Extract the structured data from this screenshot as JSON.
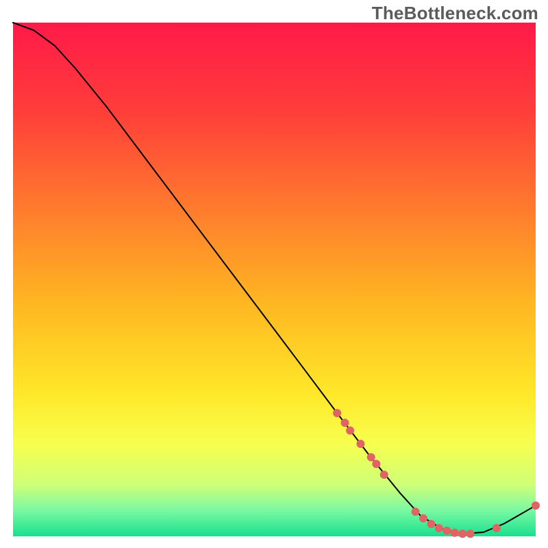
{
  "watermark": "TheBottleneck.com",
  "chart_data": {
    "type": "line",
    "title": "",
    "xlabel": "",
    "ylabel": "",
    "xlim": [
      0,
      100
    ],
    "ylim": [
      0,
      100
    ],
    "axes_visible": false,
    "grid": false,
    "background_gradient": {
      "orientation": "vertical",
      "stops": [
        {
          "offset": 0.0,
          "color": "#ff1a49"
        },
        {
          "offset": 0.17,
          "color": "#ff3d3a"
        },
        {
          "offset": 0.35,
          "color": "#ff772e"
        },
        {
          "offset": 0.55,
          "color": "#ffb822"
        },
        {
          "offset": 0.72,
          "color": "#ffe728"
        },
        {
          "offset": 0.82,
          "color": "#f7ff4e"
        },
        {
          "offset": 0.9,
          "color": "#ceff78"
        },
        {
          "offset": 0.95,
          "color": "#79f8a2"
        },
        {
          "offset": 1.0,
          "color": "#18e08e"
        }
      ]
    },
    "curve": {
      "stroke": "#000000",
      "stroke_width": 2,
      "points": [
        {
          "x": 0,
          "y": 100.0
        },
        {
          "x": 4,
          "y": 98.5
        },
        {
          "x": 8,
          "y": 95.5
        },
        {
          "x": 12,
          "y": 91.0
        },
        {
          "x": 18,
          "y": 83.5
        },
        {
          "x": 25,
          "y": 74.0
        },
        {
          "x": 35,
          "y": 60.5
        },
        {
          "x": 45,
          "y": 47.0
        },
        {
          "x": 55,
          "y": 33.5
        },
        {
          "x": 62,
          "y": 24.0
        },
        {
          "x": 68,
          "y": 16.0
        },
        {
          "x": 74,
          "y": 8.5
        },
        {
          "x": 78,
          "y": 4.0
        },
        {
          "x": 82,
          "y": 1.5
        },
        {
          "x": 86,
          "y": 0.5
        },
        {
          "x": 90,
          "y": 0.8
        },
        {
          "x": 94,
          "y": 2.5
        },
        {
          "x": 100,
          "y": 6.0
        }
      ]
    },
    "markers": {
      "fill": "#e06464",
      "radius": 6,
      "points": [
        {
          "x": 62.0,
          "y": 24.0
        },
        {
          "x": 63.5,
          "y": 22.1
        },
        {
          "x": 64.5,
          "y": 20.6
        },
        {
          "x": 66.5,
          "y": 18.0
        },
        {
          "x": 68.5,
          "y": 15.4
        },
        {
          "x": 69.5,
          "y": 14.1
        },
        {
          "x": 71.0,
          "y": 12.0
        },
        {
          "x": 77.0,
          "y": 4.8
        },
        {
          "x": 78.5,
          "y": 3.5
        },
        {
          "x": 80.0,
          "y": 2.4
        },
        {
          "x": 81.5,
          "y": 1.6
        },
        {
          "x": 83.0,
          "y": 1.1
        },
        {
          "x": 84.5,
          "y": 0.7
        },
        {
          "x": 86.0,
          "y": 0.5
        },
        {
          "x": 87.5,
          "y": 0.5
        },
        {
          "x": 92.5,
          "y": 1.6
        },
        {
          "x": 100.0,
          "y": 6.0
        }
      ]
    }
  }
}
